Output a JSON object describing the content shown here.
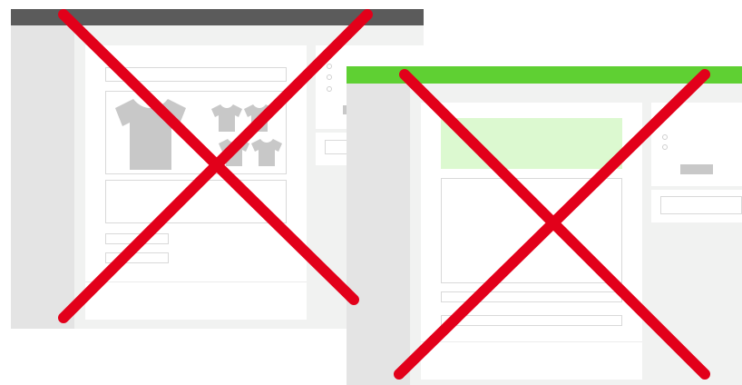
{
  "colors": {
    "left_topbar": "#5b5b5b",
    "right_topbar": "#5fd033",
    "highlight_box": "#dcf9d0",
    "cross": "#e2001a",
    "placeholder_gray": "#c8c8c8",
    "mock_background": "#f1f2f1",
    "mock_sidebar": "#e4e4e4",
    "panel_border": "#d9d9d9"
  },
  "mockups": [
    {
      "id": "left-layout",
      "topbar_color": "left_topbar",
      "crossed_out": true,
      "icons": [
        "tshirt-large-icon",
        "tshirt-small-icon",
        "tshirt-small-icon",
        "tshirt-small-icon",
        "tshirt-small-icon"
      ]
    },
    {
      "id": "right-layout",
      "topbar_color": "right_topbar",
      "crossed_out": true,
      "icons": []
    }
  ]
}
